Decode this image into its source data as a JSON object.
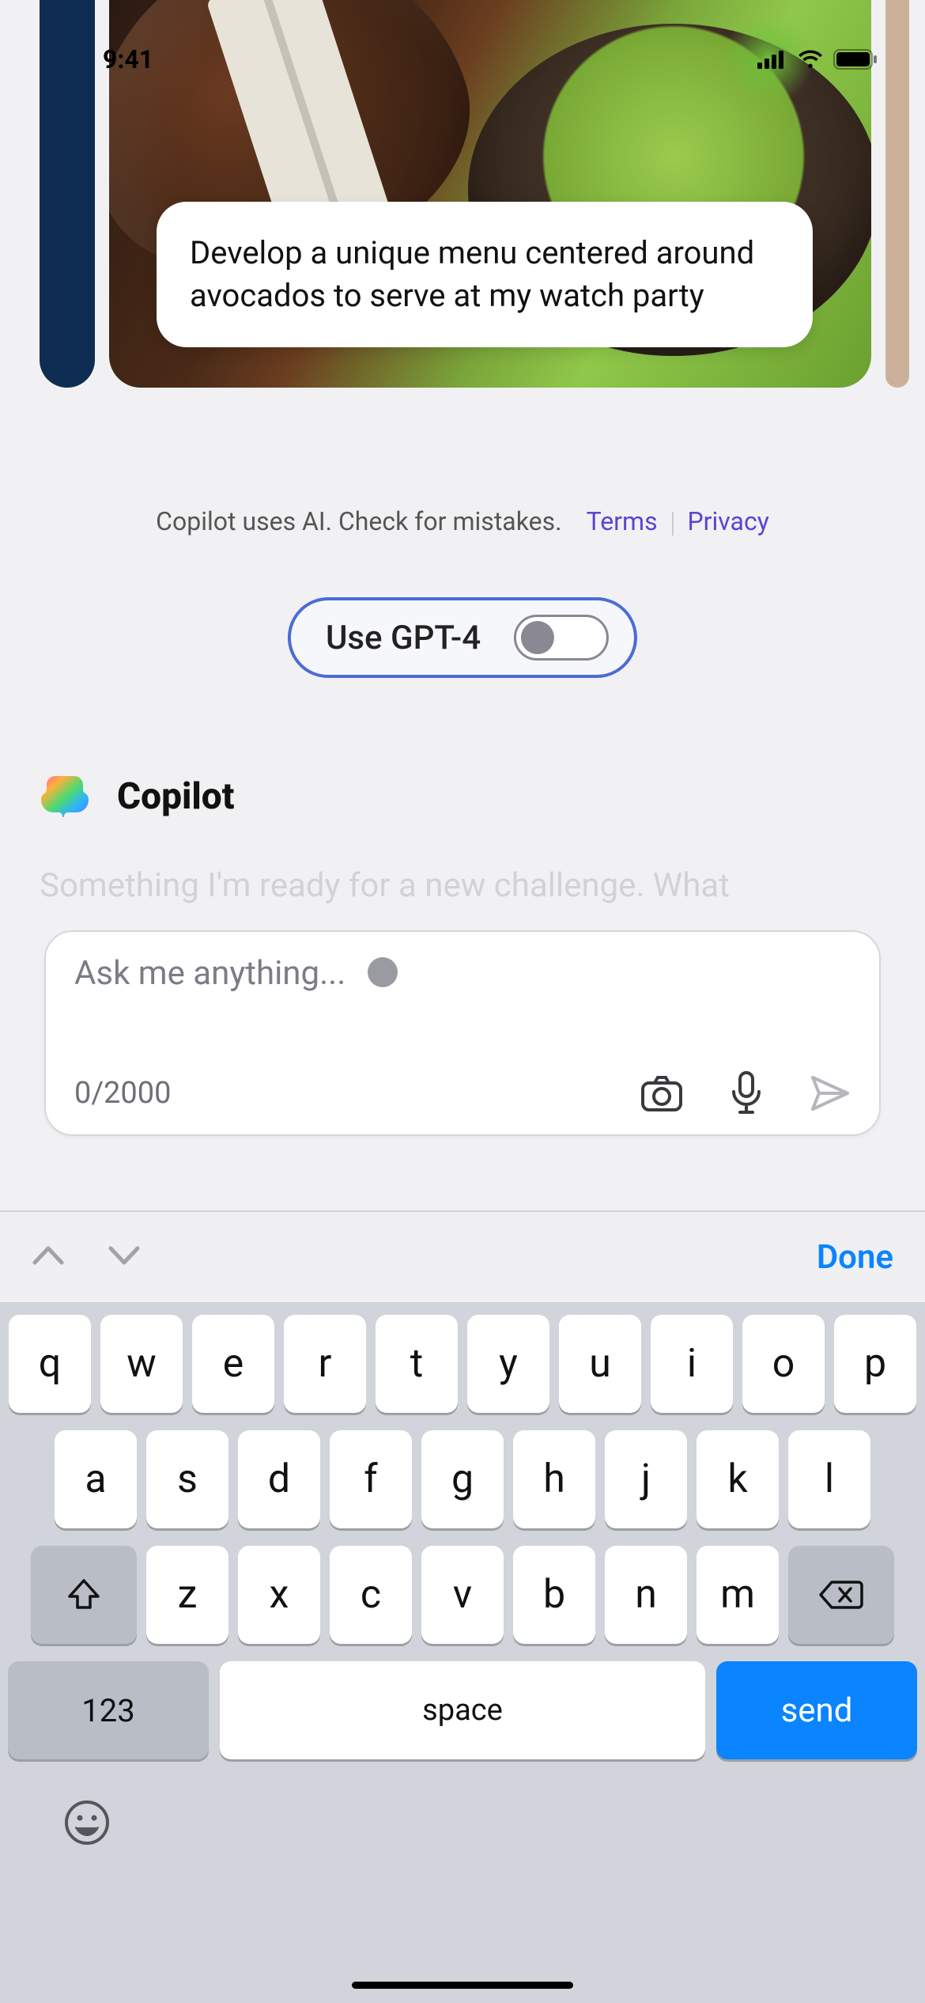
{
  "status": {
    "time": "9:41"
  },
  "hero": {
    "suggestion": "Develop a unique menu centered around avocados to serve at my watch party"
  },
  "disclaimer": {
    "text": "Copilot uses AI. Check for mistakes.",
    "terms_label": "Terms",
    "privacy_label": "Privacy"
  },
  "gpt4": {
    "label": "Use GPT-4",
    "enabled": false
  },
  "brand": {
    "name": "Copilot"
  },
  "truncated_text": "Something I'm ready for a new challenge. What",
  "input": {
    "placeholder": "Ask me anything...",
    "counter": "0/2000"
  },
  "accessory": {
    "done_label": "Done"
  },
  "keyboard": {
    "row1": [
      "q",
      "w",
      "e",
      "r",
      "t",
      "y",
      "u",
      "i",
      "o",
      "p"
    ],
    "row2": [
      "a",
      "s",
      "d",
      "f",
      "g",
      "h",
      "j",
      "k",
      "l"
    ],
    "row3": [
      "z",
      "x",
      "c",
      "v",
      "b",
      "n",
      "m"
    ],
    "numeric_label": "123",
    "space_label": "space",
    "send_label": "send"
  }
}
